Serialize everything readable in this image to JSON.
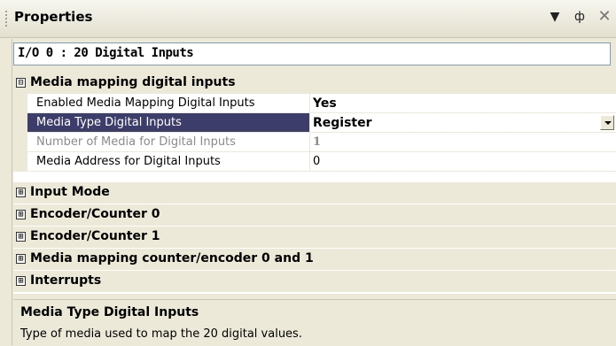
{
  "panel": {
    "title": "Properties",
    "icons": [
      "dropdown-arrow-icon",
      "pin-icon",
      "close-icon"
    ]
  },
  "selector": {
    "value": "I/O 0 : 20 Digital Inputs"
  },
  "grid": {
    "categories": [
      {
        "label": "Media mapping digital inputs",
        "expanded": true,
        "expander": "⊟",
        "properties": [
          {
            "name": "Enabled Media Mapping Digital Inputs",
            "value": "Yes"
          },
          {
            "name": "Media Type Digital Inputs",
            "value": "Register"
          },
          {
            "name": "Number of Media for Digital Inputs",
            "value": "1"
          },
          {
            "name": "Media Address for Digital Inputs",
            "value": "0"
          }
        ]
      },
      {
        "label": "Input Mode",
        "expanded": false,
        "expander": "⊞"
      },
      {
        "label": "Encoder/Counter 0",
        "expanded": false,
        "expander": "⊞"
      },
      {
        "label": "Encoder/Counter 1",
        "expanded": false,
        "expander": "⊞"
      },
      {
        "label": "Media mapping counter/encoder 0 and 1",
        "expanded": false,
        "expander": "⊞"
      },
      {
        "label": "Interrupts",
        "expanded": false,
        "expander": "⊞"
      }
    ]
  },
  "description": {
    "title": "Media Type Digital Inputs",
    "text": "Type of media used to map the 20 digital values."
  },
  "colors": {
    "selection": "#3d3d6b",
    "panel_bg": "#ece9d8"
  }
}
